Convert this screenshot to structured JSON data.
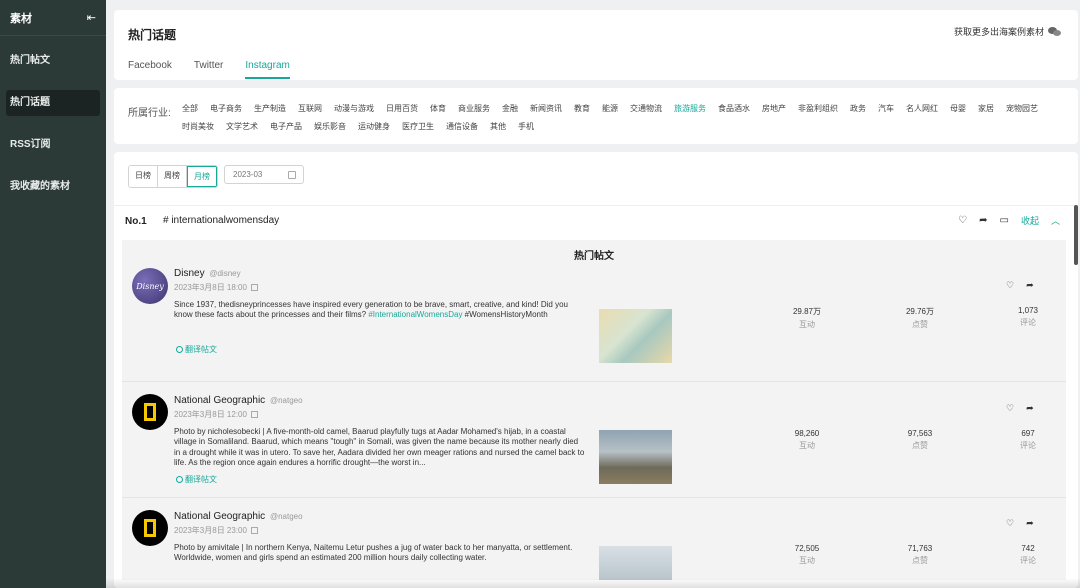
{
  "sidebar": {
    "title": "素材",
    "collapse_icon": "⇤",
    "items": [
      {
        "label": "热门帖文",
        "active": false
      },
      {
        "label": "热门话题",
        "active": true
      },
      {
        "label": "RSS订阅",
        "active": false
      },
      {
        "label": "我收藏的素材",
        "active": false
      }
    ]
  },
  "header": {
    "title": "热门话题",
    "more_link": "获取更多出海案例素材",
    "tabs": [
      {
        "label": "Facebook",
        "active": false
      },
      {
        "label": "Twitter",
        "active": false
      },
      {
        "label": "Instagram",
        "active": true
      }
    ]
  },
  "filter": {
    "label": "所属行业:",
    "industries": [
      "全部",
      "电子商务",
      "生产制造",
      "互联网",
      "动漫与游戏",
      "日用百货",
      "体育",
      "商业服务",
      "金融",
      "新闻资讯",
      "教育",
      "能源",
      "交通物流",
      "旅游服务",
      "食品酒水",
      "房地产",
      "非盈利组织",
      "政务",
      "汽车",
      "名人网红",
      "母婴",
      "家居",
      "宠物园艺",
      "时尚美妆",
      "文学艺术",
      "电子产品",
      "娱乐影音",
      "运动健身",
      "医疗卫生",
      "通信设备",
      "其他",
      "手机"
    ],
    "active_industry": "旅游服务"
  },
  "ranking": {
    "tabs": [
      {
        "label": "日榜",
        "active": false
      },
      {
        "label": "周榜",
        "active": false
      },
      {
        "label": "月榜",
        "active": true
      }
    ],
    "date": "2023-03"
  },
  "topic": {
    "rank": "No.1",
    "hashtag": "# internationalwomensday",
    "collapse_label": "收起",
    "posts_title": "热门帖文",
    "translate_label": "翻译帖文",
    "stat_labels": {
      "interactions": "互动",
      "likes": "点赞",
      "comments": "评论"
    },
    "posts": [
      {
        "author": "Disney",
        "handle": "@disney",
        "time": "2023年3月8日 18:00",
        "avatar_text": "Disney",
        "text": "Since 1937, thedisneyprincesses have inspired every generation to be brave, smart, creative, and kind! Did you know these facts about the princesses and their films? ",
        "tag": "#InternationalWomensDay",
        "text_tail": " #WomensHistoryMonth",
        "interactions": "29.87万",
        "likes": "29.76万",
        "comments": "1,073"
      },
      {
        "author": "National Geographic",
        "handle": "@natgeo",
        "time": "2023年3月8日 12:00",
        "text": "Photo by nicholesobecki | A five-month-old camel, Baarud playfully tugs at Aadar Mohamed's hijab, in a coastal village in Somaliland. Baarud, which means \"tough\" in Somali, was given the name because its mother nearly died in a drought while it was in utero. To save her, Aadara divided her own meager rations and nursed the camel back to life. As the region once again endures a horrific drought—the worst in...",
        "interactions": "98,260",
        "likes": "97,563",
        "comments": "697"
      },
      {
        "author": "National Geographic",
        "handle": "@natgeo",
        "time": "2023年3月8日 23:00",
        "text": "Photo by amivitale | In northern Kenya, Naitemu Letur pushes a jug of water back to her manyatta, or settlement. Worldwide, women and girls spend an estimated 200 million hours daily collecting water.",
        "interactions": "72,505",
        "likes": "71,763",
        "comments": "742"
      }
    ]
  },
  "colors": {
    "accent": "#16a99a",
    "sidebar": "#2c3a37"
  }
}
